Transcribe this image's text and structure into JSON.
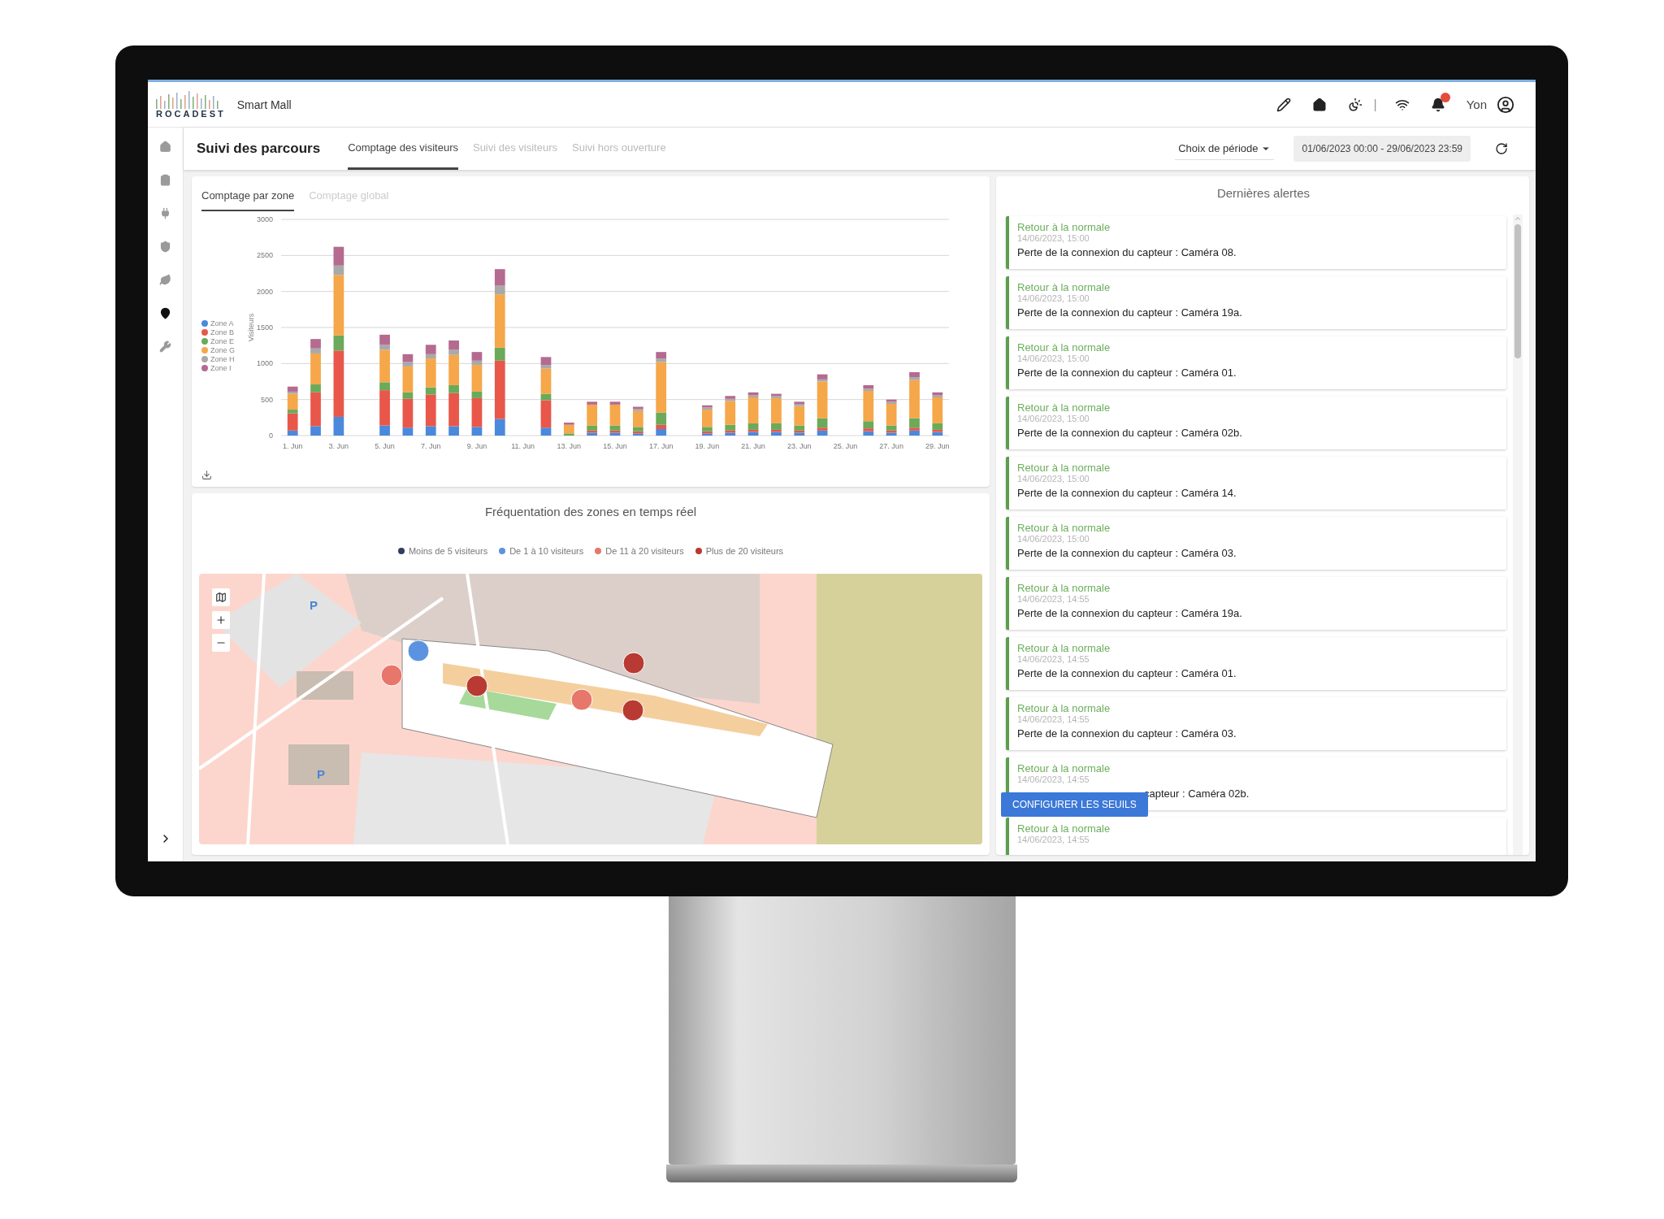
{
  "app": {
    "logo_text": "ROCADEST",
    "site": "Smart Mall",
    "user": "Yon",
    "separator": "|",
    "notifications": true
  },
  "sidebar": {
    "items": [
      {
        "kind": "home",
        "selected": false
      },
      {
        "kind": "clipboard",
        "selected": false
      },
      {
        "kind": "plug",
        "selected": false
      },
      {
        "kind": "shield",
        "selected": false
      },
      {
        "kind": "leaf",
        "selected": false
      },
      {
        "kind": "pin",
        "selected": true
      },
      {
        "kind": "wrench",
        "selected": false
      }
    ]
  },
  "page": {
    "title": "Suivi des parcours",
    "tabs": [
      {
        "label": "Comptage des visiteurs",
        "selected": true
      },
      {
        "label": "Suivi des visiteurs",
        "selected": false
      },
      {
        "label": "Suivi hors ouverture",
        "selected": false
      }
    ],
    "period_select": "Choix de période",
    "date_range": "01/06/2023 00:00 - 29/06/2023 23:59"
  },
  "chart_card": {
    "tabs": [
      {
        "label": "Comptage par zone",
        "selected": true
      },
      {
        "label": "Comptage global",
        "selected": false
      }
    ],
    "chart_data": {
      "type": "bar",
      "stacked": true,
      "grid": true,
      "ylabel": "Visiteurs",
      "ylim": [
        0,
        3000
      ],
      "yticks": [
        0,
        500,
        1000,
        1500,
        2000,
        2500,
        3000
      ],
      "categories": [
        "1. Jun",
        null,
        "3. Jun",
        null,
        "5. Jun",
        null,
        "7. Jun",
        null,
        "9. Jun",
        null,
        "11. Jun",
        null,
        "13. Jun",
        null,
        "15. Jun",
        null,
        "17. Jun",
        null,
        "19. Jun",
        null,
        "21. Jun",
        null,
        "23. Jun",
        null,
        "25. Jun",
        null,
        "27. Jun",
        null,
        "29. Jun"
      ],
      "series": [
        {
          "name": "Zone A",
          "color": "#4a89dc",
          "values": [
            70,
            130,
            260,
            0,
            140,
            110,
            130,
            130,
            120,
            230,
            0,
            110,
            0,
            40,
            40,
            30,
            90,
            0,
            30,
            40,
            50,
            50,
            40,
            70,
            0,
            60,
            40,
            70,
            50
          ]
        },
        {
          "name": "Zone B",
          "color": "#e8574a",
          "values": [
            240,
            470,
            920,
            0,
            490,
            400,
            440,
            460,
            400,
            810,
            0,
            380,
            0,
            30,
            30,
            30,
            60,
            0,
            30,
            30,
            30,
            30,
            30,
            40,
            0,
            40,
            30,
            40,
            30
          ]
        },
        {
          "name": "Zone E",
          "color": "#6aaa5a",
          "values": [
            50,
            110,
            210,
            0,
            110,
            90,
            100,
            110,
            90,
            180,
            0,
            90,
            30,
            70,
            70,
            60,
            170,
            0,
            60,
            80,
            90,
            90,
            70,
            130,
            0,
            100,
            70,
            130,
            90
          ]
        },
        {
          "name": "Zone G",
          "color": "#f5a74a",
          "values": [
            220,
            430,
            840,
            0,
            450,
            360,
            400,
            420,
            370,
            740,
            0,
            350,
            120,
            290,
            290,
            220,
            700,
            0,
            240,
            330,
            360,
            350,
            270,
            510,
            0,
            420,
            300,
            530,
            360
          ]
        },
        {
          "name": "Zone H",
          "color": "#a9a9a9",
          "values": [
            30,
            70,
            130,
            0,
            70,
            60,
            60,
            70,
            60,
            120,
            0,
            50,
            0,
            0,
            0,
            30,
            50,
            0,
            30,
            30,
            30,
            30,
            30,
            30,
            0,
            30,
            30,
            40,
            30
          ]
        },
        {
          "name": "Zone I",
          "color": "#b56a90",
          "values": [
            70,
            130,
            260,
            0,
            140,
            110,
            130,
            130,
            120,
            230,
            0,
            110,
            30,
            40,
            40,
            30,
            90,
            0,
            30,
            40,
            40,
            30,
            30,
            70,
            0,
            50,
            30,
            70,
            40
          ]
        }
      ]
    }
  },
  "map_card": {
    "title": "Fréquentation des zones en temps réel",
    "legend": [
      {
        "label": "Moins de 5 visiteurs",
        "color": "#2f3f5e"
      },
      {
        "label": "De 1 à 10 visiteurs",
        "color": "#5b93e0"
      },
      {
        "label": "De 11 à 20 visiteurs",
        "color": "#e7776a"
      },
      {
        "label": "Plus de 20 visiteurs",
        "color": "#b83a32"
      }
    ],
    "parking_labels": [
      "P",
      "P"
    ],
    "markers": [
      {
        "color": "#5b93e0"
      },
      {
        "color": "#e7776a"
      },
      {
        "color": "#b83a32"
      },
      {
        "color": "#b83a32"
      },
      {
        "color": "#e7776a"
      },
      {
        "color": "#b83a32"
      }
    ]
  },
  "alerts": {
    "title": "Dernières alertes",
    "button": "CONFIGURER LES SEUILS",
    "items": [
      {
        "status": "Retour à la normale",
        "date": "14/06/2023, 15:00",
        "text": "Perte de la connexion du capteur : Caméra 08."
      },
      {
        "status": "Retour à la normale",
        "date": "14/06/2023, 15:00",
        "text": "Perte de la connexion du capteur : Caméra 19a."
      },
      {
        "status": "Retour à la normale",
        "date": "14/06/2023, 15:00",
        "text": "Perte de la connexion du capteur : Caméra 01."
      },
      {
        "status": "Retour à la normale",
        "date": "14/06/2023, 15:00",
        "text": "Perte de la connexion du capteur : Caméra 02b."
      },
      {
        "status": "Retour à la normale",
        "date": "14/06/2023, 15:00",
        "text": "Perte de la connexion du capteur : Caméra 14."
      },
      {
        "status": "Retour à la normale",
        "date": "14/06/2023, 15:00",
        "text": "Perte de la connexion du capteur : Caméra 03."
      },
      {
        "status": "Retour à la normale",
        "date": "14/06/2023, 14:55",
        "text": "Perte de la connexion du capteur : Caméra 19a."
      },
      {
        "status": "Retour à la normale",
        "date": "14/06/2023, 14:55",
        "text": "Perte de la connexion du capteur : Caméra 01."
      },
      {
        "status": "Retour à la normale",
        "date": "14/06/2023, 14:55",
        "text": "Perte de la connexion du capteur : Caméra 03."
      },
      {
        "status": "Retour à la normale",
        "date": "14/06/2023, 14:55",
        "text": "capteur : Caméra 02b.",
        "covered": true
      },
      {
        "status": "Retour à la normale",
        "date": "14/06/2023, 14:55"
      }
    ]
  }
}
